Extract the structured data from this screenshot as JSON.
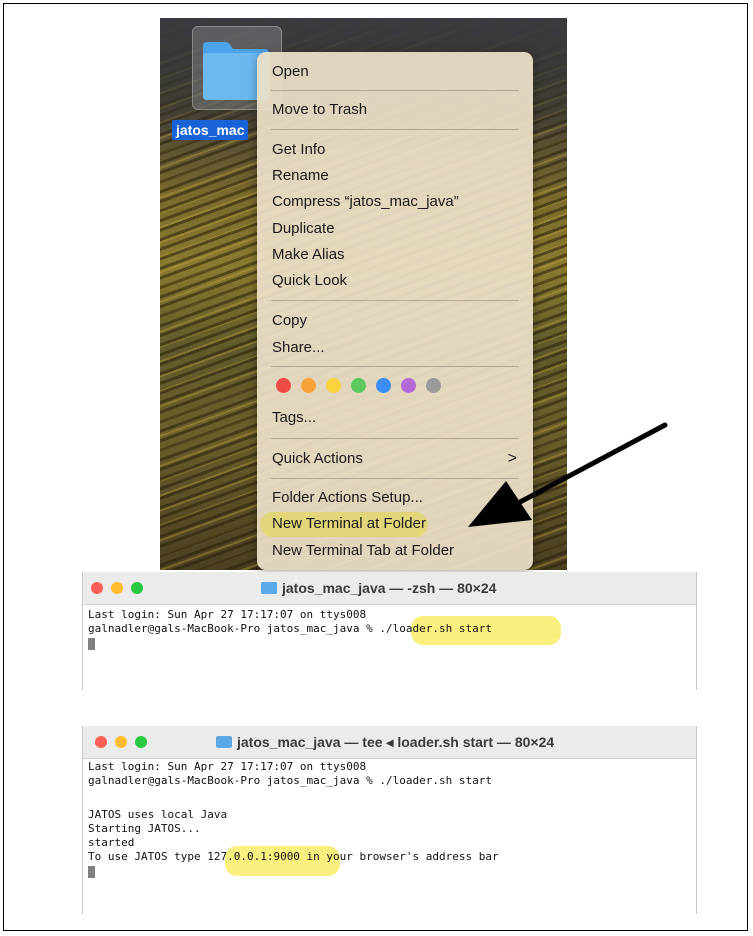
{
  "desktop": {
    "folder_label": "jatos_mac"
  },
  "context_menu": {
    "items": [
      {
        "label": "Open"
      },
      {
        "label": "Move to Trash"
      },
      {
        "label": "Get Info"
      },
      {
        "label": "Rename"
      },
      {
        "label": "Compress “jatos_mac_java”"
      },
      {
        "label": "Duplicate"
      },
      {
        "label": "Make Alias"
      },
      {
        "label": "Quick Look"
      },
      {
        "label": "Copy"
      },
      {
        "label": "Share..."
      },
      {
        "label": "Tags..."
      },
      {
        "label": "Quick Actions"
      },
      {
        "label": "Folder Actions Setup..."
      },
      {
        "label": "New Terminal at Folder"
      },
      {
        "label": "New Terminal Tab at Folder"
      }
    ],
    "tag_colors": [
      "#f04b45",
      "#f7a23a",
      "#f8d33c",
      "#5ccb5f",
      "#3a8ef6",
      "#b46ad9",
      "#9a9a9a"
    ],
    "highlight_color": "#e2d57a",
    "submenu_chevron": ">"
  },
  "terminal1": {
    "title": "jatos_mac_java — -zsh — 80×24",
    "lines": [
      "Last login: Sun Apr 27 17:17:07 on ttys008",
      "galnadler@gals-MacBook-Pro jatos_mac_java % "
    ],
    "command": "./loader.sh start"
  },
  "terminal2": {
    "title": "jatos_mac_java — tee ◂ loader.sh start — 80×24",
    "lines": [
      "Last login: Sun Apr 27 17:17:07 on ttys008",
      "galnadler@gals-MacBook-Pro jatos_mac_java % ./loader.sh start",
      "",
      "JATOS uses local Java",
      "Starting JATOS...",
      "started"
    ],
    "url_prefix": "To use JATOS type ",
    "url": "127.0.0.1:9000",
    "url_suffix": " in your browser's address bar"
  },
  "colors": {
    "selection_blue": "#1a62d8",
    "annotation_yellow": "#fbf07f",
    "close": "#ff5f57",
    "minimize": "#febc2e",
    "zoom": "#28c840"
  }
}
